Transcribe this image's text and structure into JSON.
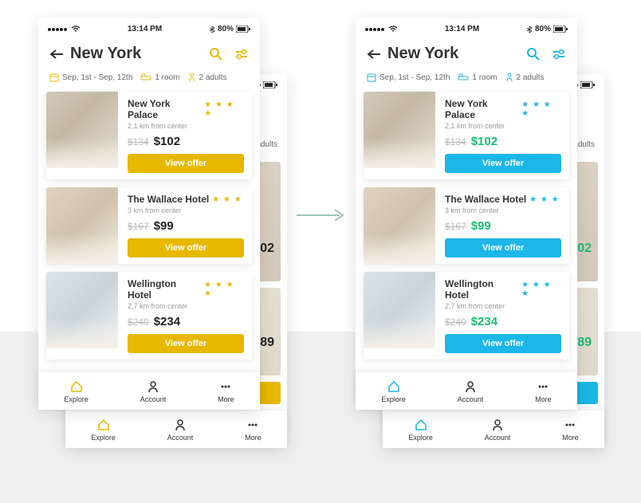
{
  "status": {
    "time": "13:14 PM",
    "battery": "80%"
  },
  "header": {
    "title": "New York"
  },
  "filters": {
    "dates": "Sep, 1st - Sep, 12th",
    "rooms": "1 room",
    "guests": "2 adults"
  },
  "hotels": [
    {
      "name": "New York Palace",
      "stars": 4,
      "distance": "2,1 km from center",
      "old_price": "$134",
      "new_price": "$102",
      "cta": "View offer"
    },
    {
      "name": "The Wallace Hotel",
      "stars": 3,
      "distance": "3 km from center",
      "old_price": "$167",
      "new_price": "$99",
      "cta": "View offer"
    },
    {
      "name": "Wellington Hotel",
      "stars": 4,
      "distance": "2,7 km from center",
      "old_price": "$240",
      "new_price": "$234",
      "cta": "View offer"
    }
  ],
  "tabs": {
    "explore": "Explore",
    "account": "Account",
    "more": "More"
  },
  "behind": {
    "p1": "02",
    "p2": "89",
    "adults": "adults"
  },
  "themes": {
    "a": {
      "accent": "#e6b800",
      "price": "#222222"
    },
    "b": {
      "accent": "#1cb6e8",
      "price": "#1abc70"
    }
  }
}
